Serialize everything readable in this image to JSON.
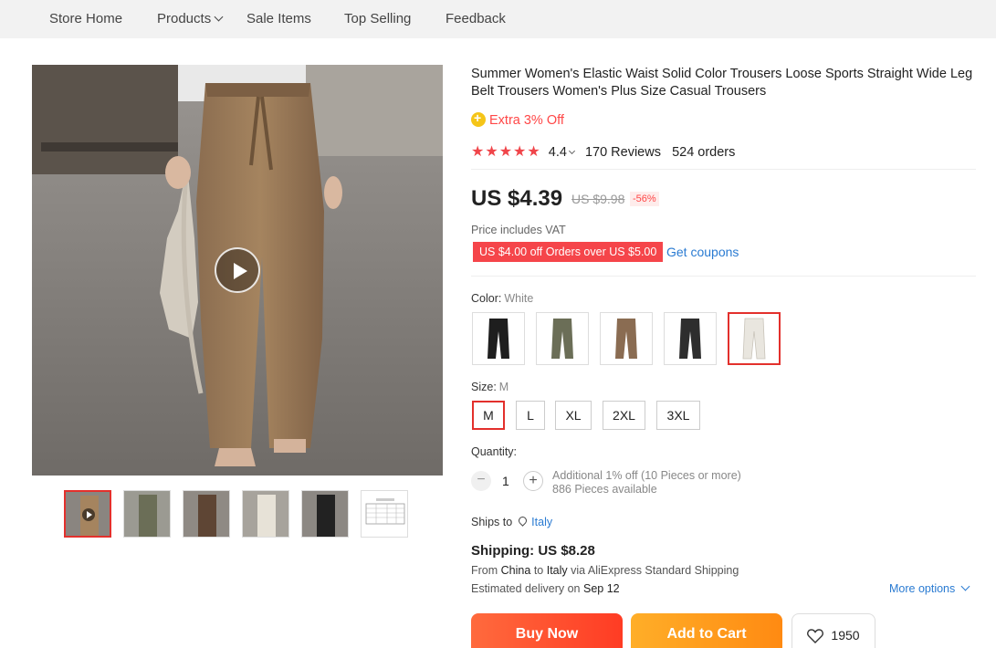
{
  "nav": {
    "items": [
      {
        "label": "Store Home"
      },
      {
        "label": "Products"
      },
      {
        "label": "Sale Items"
      },
      {
        "label": "Top Selling"
      },
      {
        "label": "Feedback"
      }
    ]
  },
  "product": {
    "title": "Summer Women's Elastic Waist Solid Color Trousers Loose Sports Straight Wide Leg Belt Trousers Women's Plus Size Casual Trousers",
    "extra_off": "Extra 3% Off",
    "rating": "4.4",
    "reviews": "170 Reviews",
    "orders": "524 orders",
    "price": "US $4.39",
    "old_price": "US $9.98",
    "discount": "-56%",
    "vat_note": "Price includes VAT",
    "coupon": "US $4.00 off Orders over US $5.00",
    "get_coupons": "Get coupons"
  },
  "colors": {
    "label": "Color:",
    "selected": "White",
    "options": [
      {
        "name": "black",
        "hex": "#1e1e1e"
      },
      {
        "name": "army-green",
        "hex": "#6b6e57"
      },
      {
        "name": "brown",
        "hex": "#8a6c52"
      },
      {
        "name": "dark-grey",
        "hex": "#2e2e2e"
      },
      {
        "name": "white",
        "hex": "#e9e6df"
      }
    ]
  },
  "sizes": {
    "label": "Size:",
    "selected": "M",
    "options": [
      "M",
      "L",
      "XL",
      "2XL",
      "3XL"
    ]
  },
  "quantity": {
    "label": "Quantity:",
    "value": "1",
    "minus": "−",
    "plus": "+",
    "note1": "Additional 1% off (10 Pieces or more)",
    "note2": "886 Pieces available"
  },
  "shipping": {
    "ships_to_label": "Ships to",
    "country": "Italy",
    "title": "Shipping: US $8.28",
    "from_prefix": "From",
    "from": "China",
    "to_word": "to",
    "to": "Italy",
    "via": "via AliExpress Standard Shipping",
    "delivery_prefix": "Estimated delivery on",
    "delivery_date": "Sep 12",
    "more_options": "More options"
  },
  "actions": {
    "buy_now": "Buy Now",
    "add_to_cart": "Add to Cart",
    "wishlist_count": "1950"
  },
  "theme": {
    "accent_red": "#ff4747",
    "link_blue": "#2a7bd2",
    "star_red": "#f0454a"
  }
}
